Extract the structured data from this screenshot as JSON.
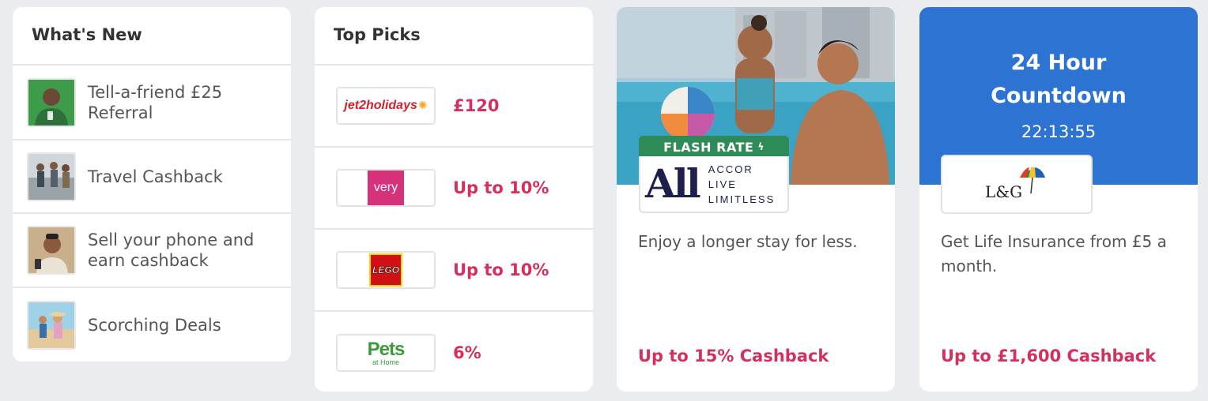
{
  "whats_new": {
    "title": "What's New",
    "items": [
      {
        "label": "Tell-a-friend £25 Referral",
        "thumb": "referral-photo"
      },
      {
        "label": "Travel Cashback",
        "thumb": "travel-photo"
      },
      {
        "label": "Sell your phone and earn cashback",
        "thumb": "phone-photo"
      },
      {
        "label": "Scorching Deals",
        "thumb": "beach-photo"
      }
    ]
  },
  "top_picks": {
    "title": "Top Picks",
    "items": [
      {
        "merchant": "jet2holidays",
        "rate": "£120"
      },
      {
        "merchant": "very",
        "rate": "Up to 10%"
      },
      {
        "merchant": "LEGO",
        "rate": "Up to 10%"
      },
      {
        "merchant": "Pets at Home",
        "logo_main": "Pets",
        "logo_sub": "at Home",
        "rate": "6%"
      }
    ]
  },
  "offers": [
    {
      "badge": "FLASH RATE",
      "logo_mark": "All",
      "logo_text": [
        "ACCOR",
        "LIVE",
        "LIMITLESS"
      ],
      "description": "Enjoy a longer stay for less.",
      "cashback": "Up to 15% Cashback"
    },
    {
      "banner_title": "24 Hour Countdown",
      "timer": "22:13:55",
      "logo_text": "L&G",
      "description": "Get Life Insurance from £5 a month.",
      "cashback": "Up to £1,600 Cashback"
    }
  ],
  "colors": {
    "accent": "#d4305d",
    "blue": "#2c73d2",
    "green": "#2e8b57",
    "bg": "#ebecef"
  }
}
